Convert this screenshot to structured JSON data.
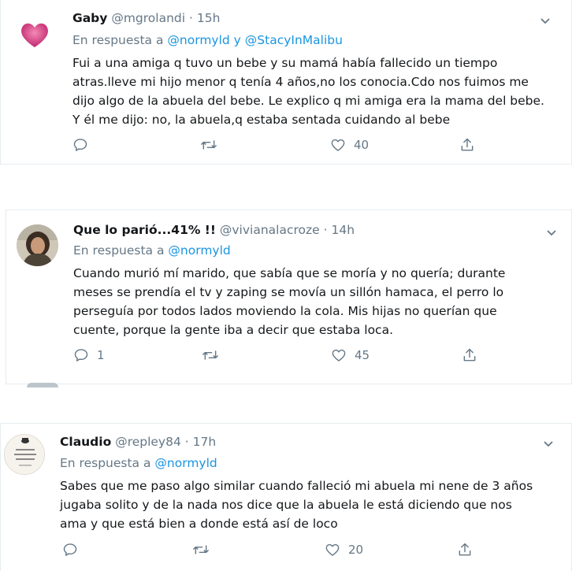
{
  "tweets": [
    {
      "name": "Gaby",
      "handle": "@mgrolandi",
      "sep": "·",
      "time": "15h",
      "reply_prefix": "En respuesta a",
      "mentions": [
        "@normyld",
        "@StacyInMalibu"
      ],
      "mention_joiner": "y",
      "lines": [
        "Fui a una amiga q tuvo un bebe y su mamá había fallecido un tiempo",
        "atras.lleve mi hijo menor q tenía 4 años,no los conocia.Cdo nos fuimos me",
        "dijo algo de la abuela del bebe. Le explico q mi amiga era la mama del bebe.",
        "Y él me dijo: no, la abuela,q estaba sentada cuidando al bebe"
      ],
      "reply_count": "",
      "retweet_count": "",
      "like_count": "40"
    },
    {
      "name": "Que lo parió...41% !!",
      "handle": "@vivianalacroze",
      "sep": "·",
      "time": "14h",
      "reply_prefix": "En respuesta a",
      "mentions": [
        "@normyld"
      ],
      "lines": [
        "Cuando murió mí marido, que sabía que se moría y no quería; durante",
        "meses se prendía el tv y zaping se movía un sillón hamaca, el perro lo",
        "perseguía por todos lados moviendo la cola. Mis hijas no querían que",
        "cuente, porque la gente iba a decir que estaba loca."
      ],
      "reply_count": "1",
      "retweet_count": "",
      "like_count": "45"
    },
    {
      "name": "Claudio",
      "handle": "@repley84",
      "sep": "·",
      "time": "17h",
      "reply_prefix": "En respuesta a",
      "mentions": [
        "@normyld"
      ],
      "lines": [
        "Sabes que me paso algo similar cuando falleció mi abuela mi nene de 3 años",
        "jugaba solito y de la nada nos dice que la abuela le está diciendo que nos",
        "ama y que está bien a donde está así de loco"
      ],
      "reply_count": "",
      "retweet_count": "",
      "like_count": "20"
    }
  ],
  "colors": {
    "text": "#14171a",
    "secondary": "#657786",
    "link": "#1b95e0",
    "border": "#e6ecf0"
  },
  "icons": [
    "reply-icon",
    "retweet-icon",
    "like-icon",
    "share-icon",
    "chevron-down-icon"
  ]
}
